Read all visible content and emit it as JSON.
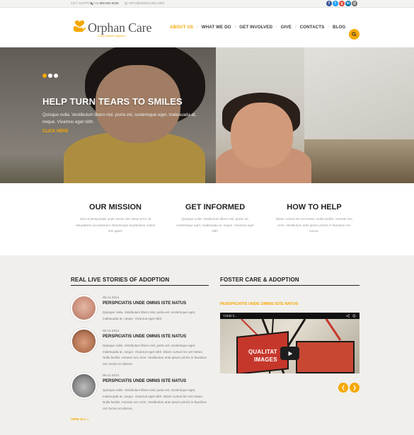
{
  "topbar": {
    "support_label": "24/7 SUPPORT",
    "phone": "+1 959 603 6035",
    "email": "INFO@DEMOLINK.ORG",
    "social_icons": [
      "facebook-icon",
      "twitter-icon",
      "google-plus-icon",
      "linkedin-icon",
      "email-icon"
    ],
    "social_letters": [
      "f",
      "t",
      "g",
      "in",
      "@"
    ],
    "social_colors": [
      "#3b5998",
      "#1da1f2",
      "#dd4b39",
      "#0077b5",
      "#6b6b6b"
    ]
  },
  "header": {
    "logo_title": "Orphan Care",
    "logo_tagline": "Good Hands Together",
    "nav": [
      {
        "label": "ABOUT US",
        "active": true
      },
      {
        "label": "WHAT WE DO",
        "active": false
      },
      {
        "label": "GET INVOLVED",
        "active": false
      },
      {
        "label": "GIVE",
        "active": false
      },
      {
        "label": "CONTACTS",
        "active": false
      },
      {
        "label": "BLOG",
        "active": false
      }
    ]
  },
  "hero": {
    "title": "HELP TURN TEARS TO SMILES",
    "text": "Quisque nulla. Vestibulum libero nisl, porta vel, scelerisque eget, malesuada at, neque. Vivamus eget nibh.",
    "link": "CLICK HERE",
    "slides_count": 3,
    "active_slide": 1
  },
  "features": [
    {
      "title": "OUR MISSION",
      "text": "Sed ut perspiciatis unde omnis iste natus error sit voluptatem accusantium doloremque laudantium, totam rem aperi."
    },
    {
      "title": "GET INFORMED",
      "text": "Quisque nulla. Vestibulum libero nisl, porta vel, scelerisque eget, malesuada at, neque. Vivamus eget nibh."
    },
    {
      "title": "HOW TO HELP",
      "text": "Etiam cursus leo vel metus. Nulla facilisi. Aenean nec eros. Vestibulum ante ipsum primis in faucibus orci luctus."
    }
  ],
  "stories": {
    "title": "REAL LIVE STORIES OF ADOPTION",
    "items": [
      {
        "date": "05-11-2014",
        "title": "PERSPICIATIS UNDE OMNIS ISTE NATUS",
        "text": "Quisque nulla. Vestibulum libero nisl, porta vel, scelerisque eget, malesuada at, neque. Vivamus eget nibh."
      },
      {
        "date": "05-11-2014",
        "title": "PERSPICIATIS UNDE OMNIS ISTE NATUS",
        "text": "Quisque nulla. Vestibulum libero nisl, porta vel, scelerisque eget, malesuada at, neque. Vivamus eget nibh. Etiam cursus leo vel metus. Nulla facilisi. Aenean nec eros. Vestibulum ante ipsum primis in faucibus orci luctus et ultrices."
      },
      {
        "date": "05-11-2014",
        "title": "PERSPICIATIS UNDE OMNIS ISTE NATUS",
        "text": "Quisque nulla. Vestibulum libero nisl, porta vel, scelerisque eget, malesuada at, neque. Vivamus eget nibh. Etiam cursus leo vel metus. Nulla facilisi. Aenean nec eros. Vestibulum ante ipsum primis in faucibus orci luctus et ultrices."
      }
    ],
    "view_all": "VIEW ALL"
  },
  "foster": {
    "title": "FOSTER CARE & ADOPTION",
    "subtitle": "PERSPICIATIS UNDE OMNIS ISTE NATUS",
    "video_id": "71830 h...",
    "video_text_1": "QUALITAT",
    "video_text_2": "IMAGES"
  },
  "colors": {
    "accent": "#f5a800",
    "dark_text": "#222222",
    "muted_text": "#777777",
    "lower_bg": "#f1efec"
  }
}
